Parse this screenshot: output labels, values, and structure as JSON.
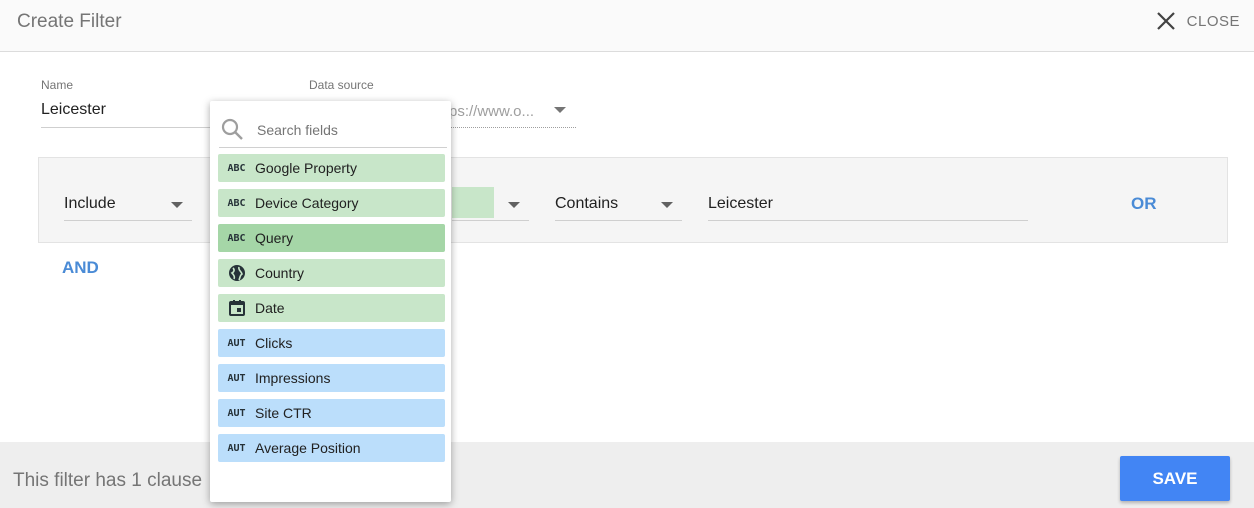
{
  "header": {
    "title": "Create Filter",
    "close_label": "CLOSE"
  },
  "form": {
    "name_label": "Name",
    "name_value": "Leicester",
    "datasource_label": "Data source",
    "datasource_value": "ps://www.o..."
  },
  "clause": {
    "include_value": "Include",
    "operator_value": "Contains",
    "match_value": "Leicester",
    "or_label": "OR"
  },
  "and_label": "AND",
  "footer": {
    "summary": "This filter has 1 clause",
    "save_label": "SAVE"
  },
  "dropdown": {
    "search_placeholder": "Search fields",
    "items": [
      {
        "label": "Google Property",
        "type_tag": "ABC",
        "kind": "dimension"
      },
      {
        "label": "Device Category",
        "type_tag": "ABC",
        "kind": "dimension"
      },
      {
        "label": "Query",
        "type_tag": "ABC",
        "kind": "dimension",
        "highlighted": true
      },
      {
        "label": "Country",
        "icon": "globe-icon",
        "kind": "dimension"
      },
      {
        "label": "Date",
        "icon": "calendar-icon",
        "kind": "dimension"
      },
      {
        "label": "Clicks",
        "type_tag": "AUT",
        "kind": "metric"
      },
      {
        "label": "Impressions",
        "type_tag": "AUT",
        "kind": "metric"
      },
      {
        "label": "Site CTR",
        "type_tag": "AUT",
        "kind": "metric"
      },
      {
        "label": "Average Position",
        "type_tag": "AUT",
        "kind": "metric"
      }
    ]
  },
  "colors": {
    "accent": "#4285f4",
    "link": "#4a8bd6",
    "dimension": "#c8e6c9",
    "metric": "#bbdefb"
  }
}
